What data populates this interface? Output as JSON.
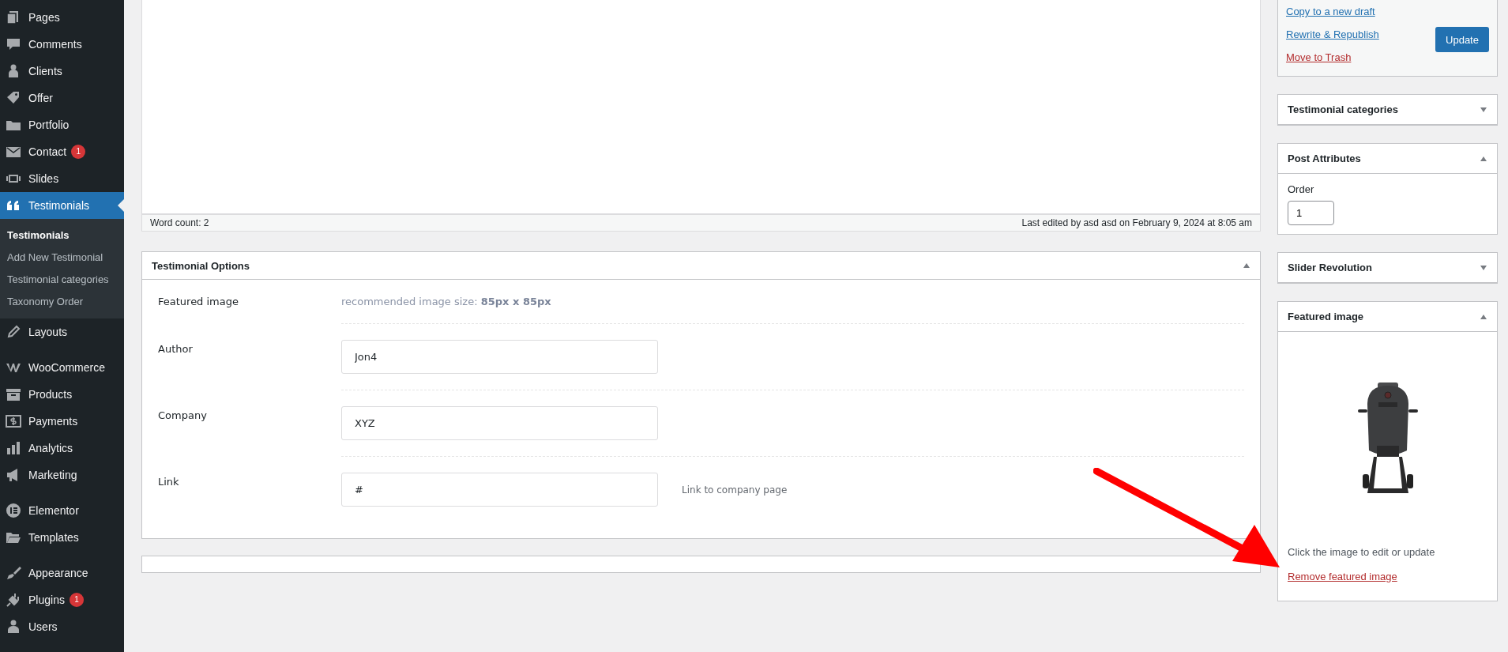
{
  "sidebar": {
    "groups": [
      {
        "items": [
          {
            "label": "Pages",
            "selected": false
          },
          {
            "label": "Comments",
            "selected": false
          },
          {
            "label": "Clients",
            "selected": false
          },
          {
            "label": "Offer",
            "selected": false
          },
          {
            "label": "Portfolio",
            "selected": false
          },
          {
            "label": "Contact",
            "selected": false,
            "badge": "1"
          },
          {
            "label": "Slides",
            "selected": false
          },
          {
            "label": "Testimonials",
            "selected": true,
            "children": [
              {
                "label": "Testimonials",
                "selected": true
              },
              {
                "label": "Add New Testimonial",
                "selected": false
              },
              {
                "label": "Testimonial categories",
                "selected": false
              },
              {
                "label": "Taxonomy Order",
                "selected": false
              }
            ]
          },
          {
            "label": "Layouts",
            "selected": false
          }
        ]
      },
      {
        "items": [
          {
            "label": "WooCommerce",
            "selected": false
          },
          {
            "label": "Products",
            "selected": false
          },
          {
            "label": "Payments",
            "selected": false
          },
          {
            "label": "Analytics",
            "selected": false
          },
          {
            "label": "Marketing",
            "selected": false
          }
        ]
      },
      {
        "items": [
          {
            "label": "Elementor",
            "selected": false
          },
          {
            "label": "Templates",
            "selected": false
          }
        ]
      },
      {
        "items": [
          {
            "label": "Appearance",
            "selected": false
          },
          {
            "label": "Plugins",
            "selected": false,
            "badge": "1"
          },
          {
            "label": "Users",
            "selected": false
          }
        ]
      }
    ]
  },
  "editor": {
    "word_count": "Word count: 2",
    "last_edited": "Last edited by asd asd on February 9, 2024 at 8:05 am"
  },
  "testimonial_options": {
    "title": "Testimonial Options",
    "expanded": true,
    "fields": [
      {
        "kind": "note",
        "label": "Featured image",
        "note": "recommended image size: **85px x 85px**"
      },
      {
        "kind": "input",
        "label": "Author",
        "value": "Jon4"
      },
      {
        "kind": "input",
        "label": "Company",
        "value": "XYZ"
      },
      {
        "kind": "input",
        "label": "Link",
        "value": "#",
        "hint": "Link to company page"
      }
    ]
  },
  "publish": {
    "links": [
      {
        "label": "Copy to a new draft",
        "kind": "link"
      },
      {
        "label": "Rewrite & Republish",
        "kind": "link"
      },
      {
        "label": "Move to Trash",
        "kind": "delete"
      }
    ],
    "button": "Update"
  },
  "boxes": [
    {
      "title": "Testimonial categories",
      "expanded": false
    },
    {
      "title": "Post Attributes",
      "expanded": true,
      "kind": "attributes",
      "field_label": "Order",
      "field_value": "1"
    },
    {
      "title": "Slider Revolution",
      "expanded": false
    },
    {
      "title": "Featured image",
      "expanded": true,
      "kind": "image",
      "caption": "Click the image to edit or update",
      "remove_link": "Remove featured image"
    }
  ]
}
